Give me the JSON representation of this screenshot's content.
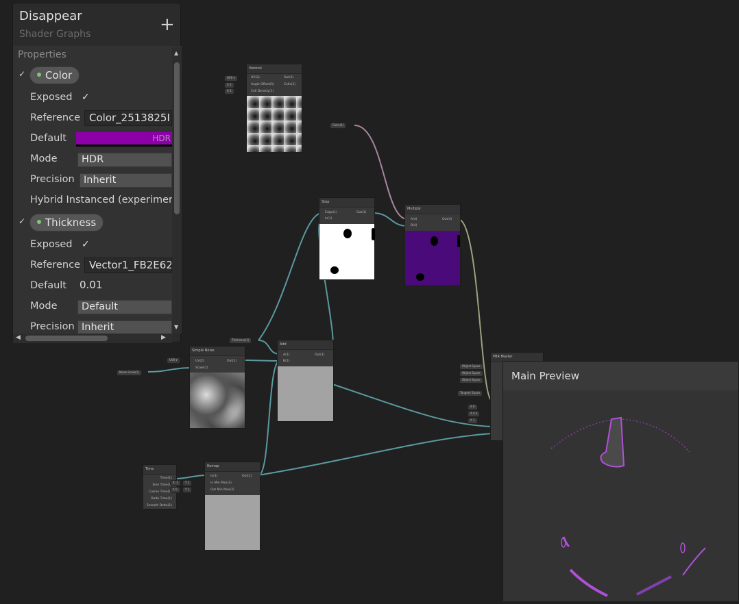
{
  "blackboard": {
    "title": "Disappear",
    "subtitle": "Shader Graphs",
    "add_label": "+",
    "section_label": "Properties",
    "properties": [
      {
        "name": "Color",
        "exposed_label": "Exposed",
        "exposed_check": "✓",
        "reference_label": "Reference",
        "reference_value": "Color_2513825I",
        "default_label": "Default",
        "default_color": "#8c00a8",
        "default_hdr": "HDR",
        "mode_label": "Mode",
        "mode_value": "HDR",
        "precision_label": "Precision",
        "precision_value": "Inherit",
        "hybrid_label": "Hybrid Instanced (experiment"
      },
      {
        "name": "Thickness",
        "exposed_label": "Exposed",
        "exposed_check": "✓",
        "reference_label": "Reference",
        "reference_value": "Vector1_FB2E62",
        "default_label": "Default",
        "default_value": "0.01",
        "mode_label": "Mode",
        "mode_value": "Default",
        "precision_label": "Precision",
        "precision_value": "Inherit"
      }
    ]
  },
  "nodes": {
    "voronoi": {
      "title": "Voronoi",
      "in": [
        "UV(2)",
        "Angle Offset(1)",
        "Cell Density(1)"
      ],
      "out": [
        "Out(1)",
        "Cells(1)"
      ],
      "uv_chip": "UV0 ▾",
      "x_chips": [
        "X  2",
        "X  5"
      ]
    },
    "color_prop": {
      "label": "Color(4)"
    },
    "step": {
      "title": "Step",
      "in": [
        "Edge(1)",
        "In(1)"
      ],
      "out": [
        "Out(1)"
      ]
    },
    "multiply": {
      "title": "Multiply",
      "in": [
        "A(4)",
        "B(4)"
      ],
      "out": [
        "Out(4)"
      ]
    },
    "thickness_prop": {
      "label": "Thickness(1)"
    },
    "add": {
      "title": "Add",
      "in": [
        "A(1)",
        "B(1)"
      ],
      "out": [
        "Out(1)"
      ]
    },
    "simple_noise": {
      "title": "Simple Noise",
      "in": [
        "UV(2)",
        "Scale(1)"
      ],
      "out": [
        "Out(1)"
      ],
      "uv_chip": "UV0 ▾"
    },
    "noise_scale_prop": {
      "label": "Noise Scale(1)"
    },
    "pbr_master": {
      "title": "PBR Master",
      "chips": [
        "Object Space",
        "Object Space",
        "Object Space",
        "Tangent Space",
        "X  0",
        "X  0.5",
        "X  1"
      ]
    },
    "time": {
      "title": "Time",
      "out": [
        "Time(1)",
        "Sine Time(1)",
        "Cosine Time(1)",
        "Delta Time(1)",
        "Smooth Delta(1)"
      ]
    },
    "remap": {
      "title": "Remap",
      "in": [
        "In(1)",
        "In Min Max(2)",
        "Out Min Max(2)"
      ],
      "out": [
        "Out(1)"
      ],
      "chips": [
        "X  -1",
        "Y  1",
        "X  0",
        "Y  1"
      ]
    }
  },
  "main_preview": {
    "title": "Main Preview"
  },
  "colors": {
    "accent_purple": "#8c00a8",
    "multiply_preview": "#4a0a7a",
    "wire": "#5a9aa0",
    "wire_color": "#a07a9a"
  }
}
